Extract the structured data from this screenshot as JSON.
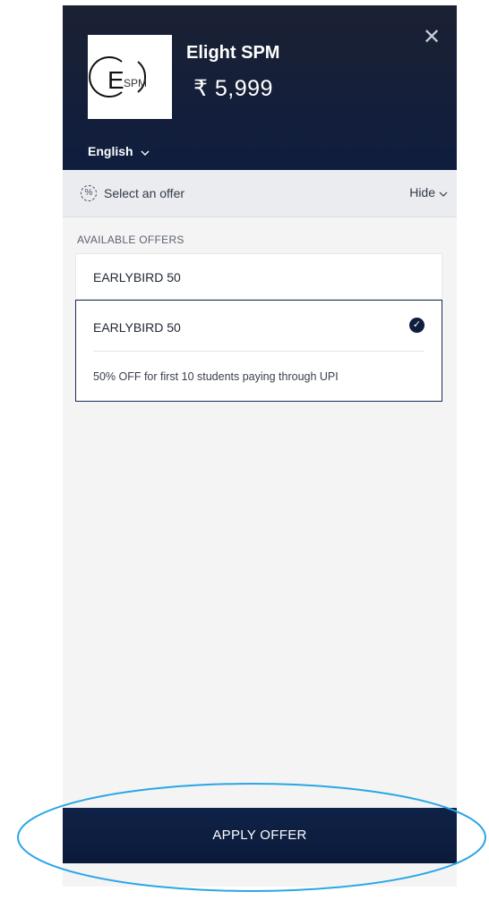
{
  "header": {
    "logo": {
      "text": "ESPM",
      "icon": "espm-logo"
    },
    "title": "Elight SPM",
    "price": "₹ 5,999",
    "close_icon": "close-icon",
    "language": {
      "label": "English",
      "icon": "chevron-down-icon"
    }
  },
  "offer_bar": {
    "label": "Select an offer",
    "icon": "percent-badge-icon",
    "toggle_label": "Hide",
    "toggle_icon": "chevron-down-icon"
  },
  "offers": {
    "heading": "AVAILABLE OFFERS",
    "items": [
      {
        "code": "EARLYBIRD 50",
        "selected": false
      },
      {
        "code": "EARLYBIRD 50",
        "selected": true,
        "description": "50% OFF for first 10 students paying through UPI",
        "check_icon": "check-circle-icon"
      }
    ]
  },
  "footer": {
    "apply_label": "APPLY OFFER"
  },
  "colors": {
    "header_bg": "#0f1d3e",
    "selected_border": "#1a2b55",
    "apply_bg": "#0b1a3a",
    "annotation_stroke": "#2aa6e6"
  }
}
